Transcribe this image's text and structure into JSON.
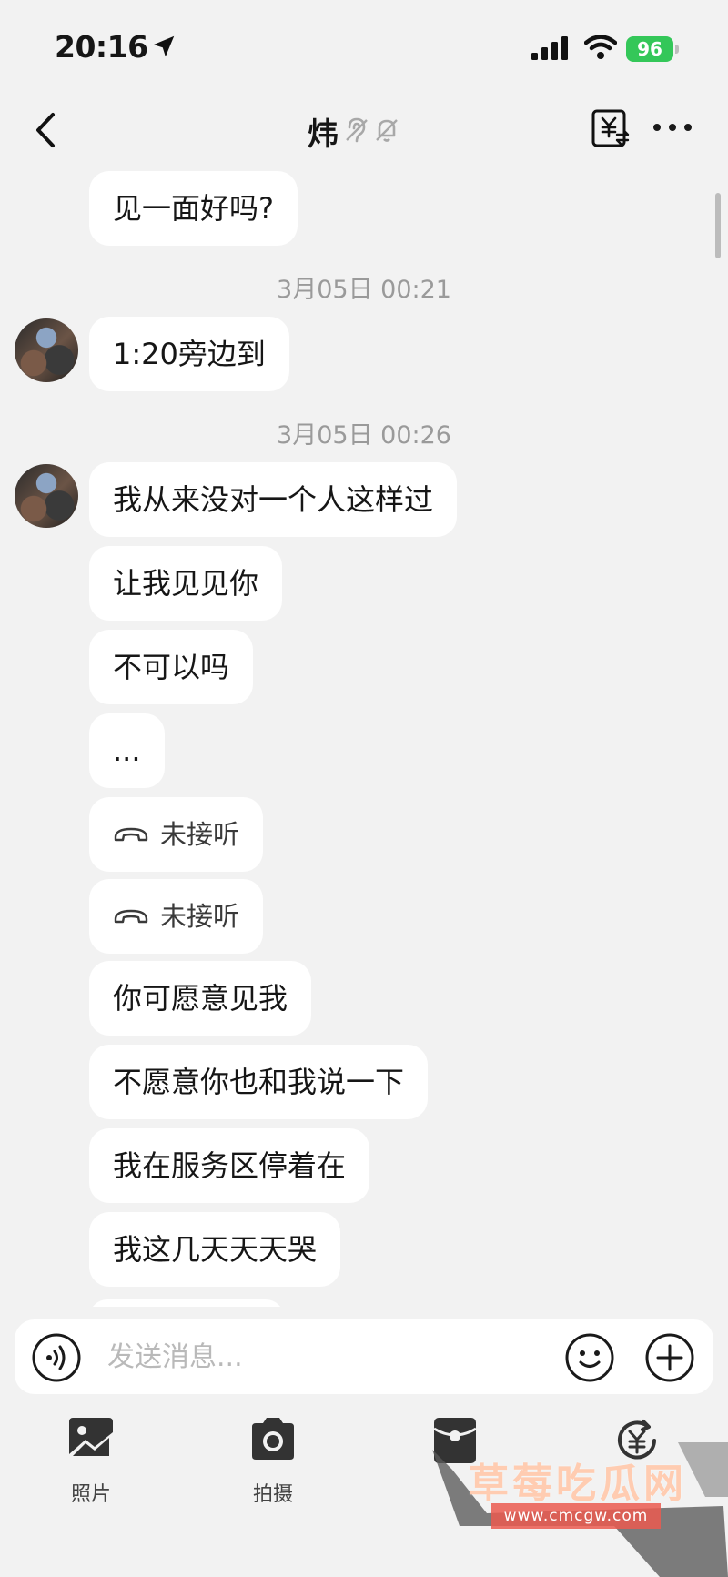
{
  "status_bar": {
    "time": "20:16",
    "battery": "96",
    "icons": [
      "location-arrow-icon",
      "signal-icon",
      "wifi-icon",
      "battery-charging-icon"
    ]
  },
  "header": {
    "title": "炜",
    "icons": [
      "back-icon",
      "ear-icon",
      "bell-muted-icon",
      "currency-exchange-icon",
      "more-icon"
    ]
  },
  "chat": {
    "first_message": "见一面好吗?",
    "timestamp_1": "3月05日 00:21",
    "message_1_20": "1:20旁边到",
    "timestamp_2": "3月05日 00:26",
    "messages": [
      "我从来没对一个人这样过",
      "让我见见你",
      "不可以吗",
      "...",
      "未接听",
      "未接听",
      "你可愿意见我",
      "不愿意你也和我说一下",
      "我在服务区停着在",
      "我这几天天天哭"
    ]
  },
  "input": {
    "placeholder": "发送消息..."
  },
  "toolbar": {
    "photo_label": "照片",
    "camera_label": "拍摄"
  },
  "watermark": {
    "text": "草莓吃瓜网",
    "url": "www.cmcgw.com"
  },
  "colors": {
    "background": "#f2f2f2",
    "bubble": "#ffffff",
    "battery": "#34c759",
    "timestamp": "#9a9a9a"
  }
}
